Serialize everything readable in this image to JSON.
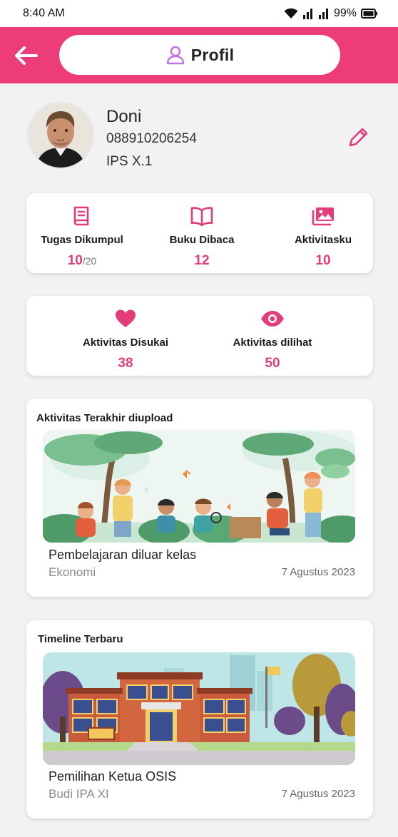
{
  "status_bar": {
    "time": "8:40 AM",
    "battery": "99%"
  },
  "app_bar": {
    "title": "Profil"
  },
  "profile": {
    "name": "Doni",
    "phone": "088910206254",
    "class": "IPS X.1"
  },
  "stats": [
    {
      "label": "Tugas Dikumpul",
      "value": "10",
      "total": "/20",
      "icon": "book-icon"
    },
    {
      "label": "Buku Dibaca",
      "value": "12",
      "icon": "open-book-icon"
    },
    {
      "label": "Aktivitasku",
      "value": "10",
      "icon": "images-icon"
    }
  ],
  "activity_stats": [
    {
      "label": "Aktivitas Disukai",
      "value": "38",
      "icon": "heart-icon"
    },
    {
      "label": "Aktivitas dilihat",
      "value": "50",
      "icon": "eye-icon"
    }
  ],
  "latest_activity": {
    "section_title": "Aktivitas Terakhir diupload",
    "title": "Pembelajaran diluar kelas",
    "subject": "Ekonomi",
    "date": "7 Agustus 2023"
  },
  "timeline": {
    "section_title": "Timeline Terbaru",
    "title": "Pemilihan Ketua OSIS",
    "author": "Budi IPA XI",
    "date": "7 Agustus 2023"
  },
  "colors": {
    "accent": "#ec3d7a",
    "stat_value": "#e23c79",
    "background": "#f2f2f2"
  }
}
